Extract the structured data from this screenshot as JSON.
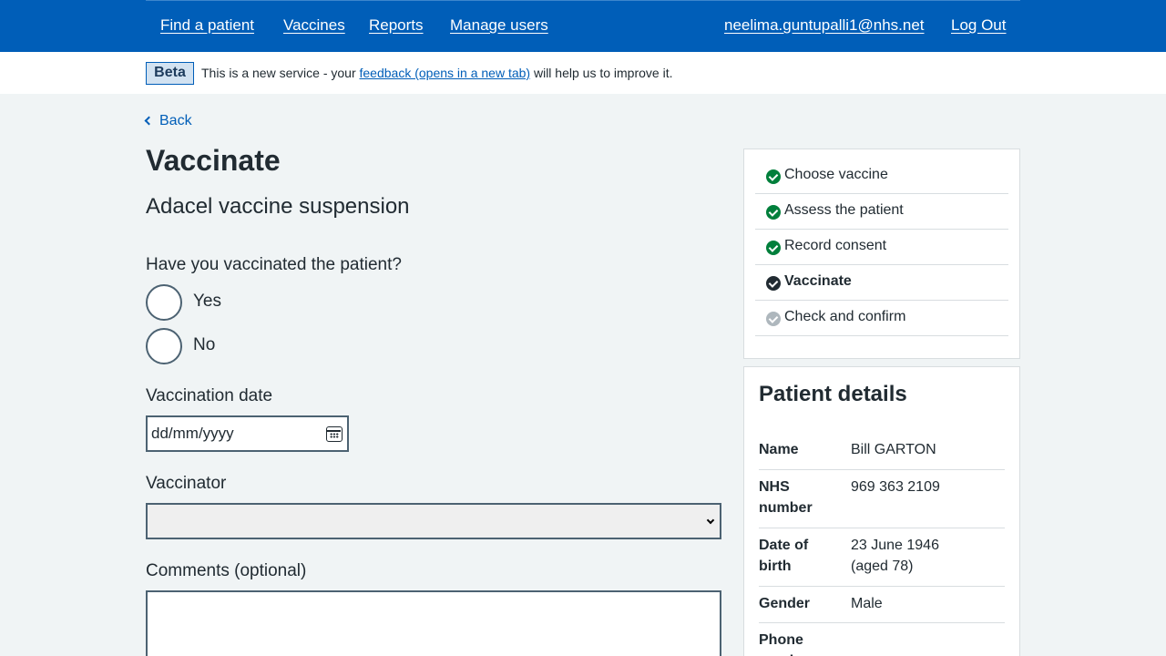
{
  "header": {
    "nav": [
      {
        "label": "Find a patient"
      },
      {
        "label": "Vaccines"
      },
      {
        "label": "Reports"
      },
      {
        "label": "Manage users"
      }
    ],
    "user_email": "neelima.guntupalli1@nhs.net",
    "logout_label": "Log Out"
  },
  "beta": {
    "tag": "Beta",
    "text_before": "This is a new service - your ",
    "link_text": "feedback (opens in a new tab)",
    "text_after": " will help us to improve it."
  },
  "back_label": "Back",
  "page_title": "Vaccinate",
  "vaccine_name": "Adacel vaccine suspension",
  "form": {
    "question": "Have you vaccinated the patient?",
    "options": [
      {
        "label": "Yes"
      },
      {
        "label": "No"
      }
    ],
    "date_label": "Vaccination date",
    "date_placeholder": "dd/mm/yyyy",
    "vaccinator_label": "Vaccinator",
    "vaccinator_value": "",
    "comments_label": "Comments (optional)"
  },
  "steps": [
    {
      "label": "Choose vaccine",
      "status": "complete",
      "color": "#007f3b"
    },
    {
      "label": "Assess the patient",
      "status": "complete",
      "color": "#007f3b"
    },
    {
      "label": "Record consent",
      "status": "complete",
      "color": "#007f3b"
    },
    {
      "label": "Vaccinate",
      "status": "current",
      "color": "#212b32"
    },
    {
      "label": "Check and confirm",
      "status": "pending",
      "color": "#aeb7bd"
    }
  ],
  "patient": {
    "title": "Patient details",
    "rows": [
      {
        "key": "Name",
        "value": "Bill GARTON"
      },
      {
        "key": "NHS number",
        "value": "969 363 2109"
      },
      {
        "key": "Date of birth",
        "value": "23 June 1946 (aged 78)"
      },
      {
        "key": "Gender",
        "value": "Male"
      },
      {
        "key": "Phone number",
        "value": ""
      }
    ]
  },
  "colors": {
    "brand_blue": "#005eb8",
    "page_background": "#f0f4f5",
    "complete_green": "#007f3b"
  }
}
